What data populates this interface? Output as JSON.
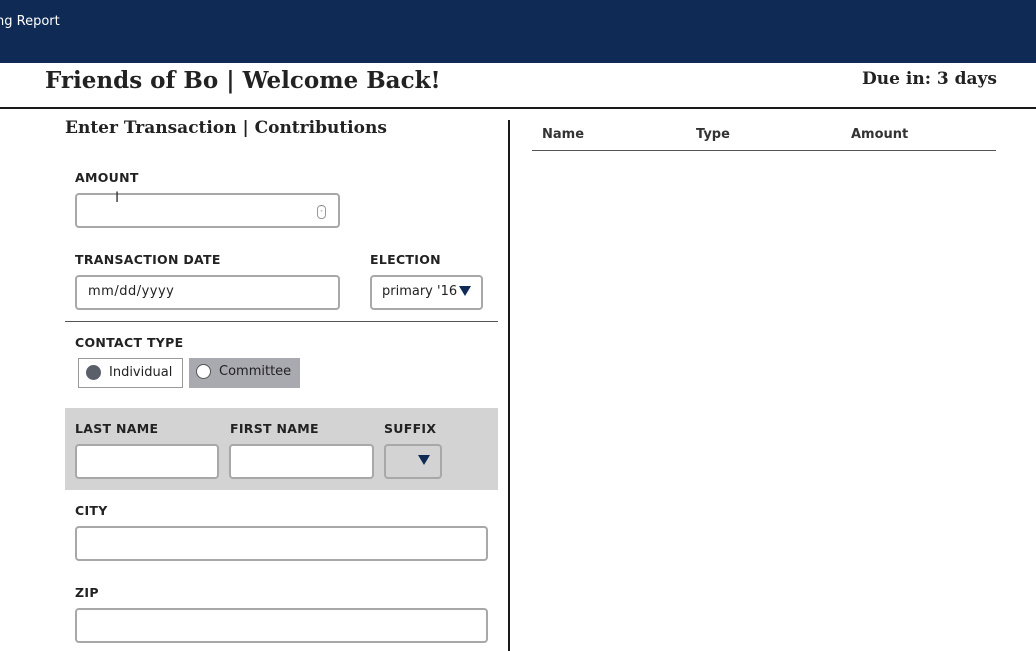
{
  "nav": {
    "report_link": "ng Report"
  },
  "header": {
    "title": "Friends of Bo | Welcome Back!",
    "due": "Due in: 3 days"
  },
  "form": {
    "title": "Enter Transaction | Contributions",
    "amount": {
      "label": "AMOUNT",
      "value": ""
    },
    "transaction_date": {
      "label": "TRANSACTION DATE",
      "placeholder": "mm/dd/yyyy"
    },
    "election": {
      "label": "ELECTION",
      "value": "primary '16"
    },
    "contact_type": {
      "label": "CONTACT TYPE",
      "options": [
        "Individual",
        "Committee"
      ],
      "selected": "Individual"
    },
    "last_name": {
      "label": "LAST NAME",
      "value": ""
    },
    "first_name": {
      "label": "FIRST NAME",
      "value": ""
    },
    "suffix": {
      "label": "SUFFIX",
      "value": ""
    },
    "city": {
      "label": "CITY",
      "value": ""
    },
    "zip": {
      "label": "ZIP",
      "value": ""
    }
  },
  "table": {
    "columns": [
      "Name",
      "Type",
      "Amount"
    ],
    "rows": []
  },
  "colors": {
    "navbar": "#0f2a55",
    "selected_radio": "#5a5f6a",
    "gray_panel": "#d3d3d3",
    "committee_bg": "#a9a9b0"
  }
}
